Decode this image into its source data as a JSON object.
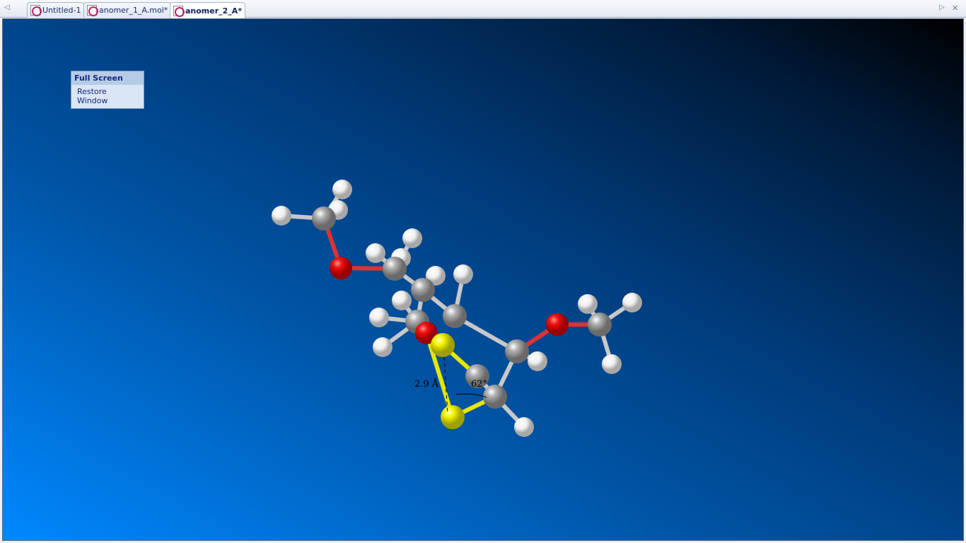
{
  "tabs": [
    {
      "label": "Untitled-1",
      "active": false
    },
    {
      "label": "anomer_1_A.mol*",
      "active": false
    },
    {
      "label": "anomer_2_A*",
      "active": true
    }
  ],
  "context_menu": {
    "header": "Full Screen",
    "items": [
      "Restore Window"
    ]
  },
  "measurements": {
    "distance": "2.9 Å",
    "angle": "62°"
  },
  "colors": {
    "carbon": "#a0a0a0",
    "hydrogen": "#f0f0f0",
    "oxygen": "#e01010",
    "sulfur": "#f0f000"
  }
}
